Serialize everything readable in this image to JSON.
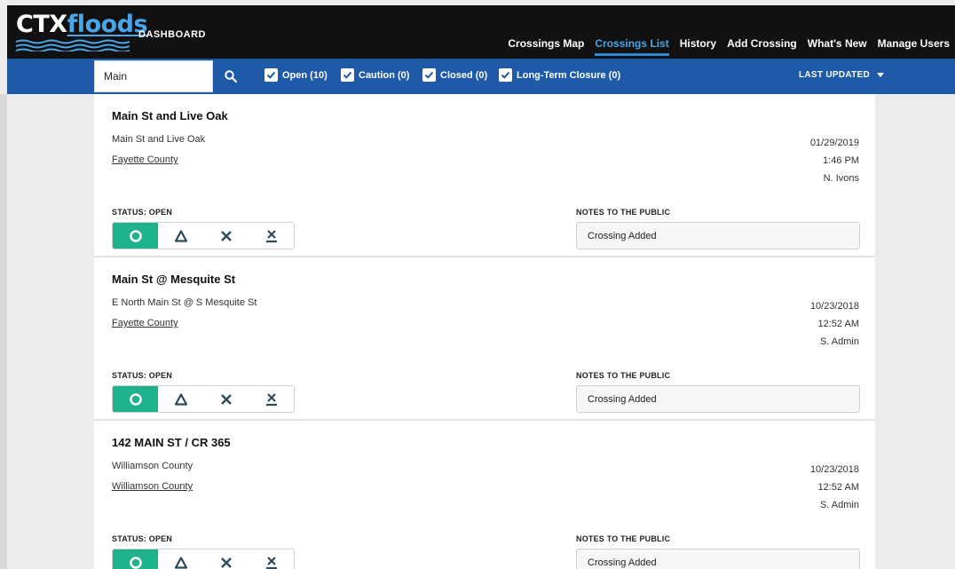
{
  "header": {
    "logo_text_1": "CTX",
    "logo_text_2": "floods",
    "section_label": "DASHBOARD",
    "nav": [
      {
        "label": "Crossings Map"
      },
      {
        "label": "Crossings List"
      },
      {
        "label": "History"
      },
      {
        "label": "Add Crossing"
      },
      {
        "label": "What's New"
      },
      {
        "label": "Manage Users"
      }
    ],
    "active_nav": "Crossings List",
    "colors": {
      "bar": "#111111",
      "accent": "#49a6ea"
    }
  },
  "filters": {
    "search_value": "Main",
    "search_icon": "search-icon",
    "options": [
      {
        "label": "Open (10)",
        "checked": true
      },
      {
        "label": "Caution (0)",
        "checked": true
      },
      {
        "label": "Closed (0)",
        "checked": true
      },
      {
        "label": "Long-Term Closure (0)",
        "checked": true
      }
    ],
    "sort_label": "LAST UPDATED",
    "colors": {
      "bar": "#1f5aa8"
    }
  },
  "crossings": [
    {
      "title": "Main St and Live Oak",
      "address": "Main St and Live Oak",
      "county": "Fayette County",
      "date": "01/29/2019",
      "time": "1:46 PM",
      "user": "N. Ivons",
      "status_label": "STATUS: OPEN",
      "notes_label": "NOTES TO THE PUBLIC",
      "notes": "Crossing Added",
      "active_status": "open"
    },
    {
      "title": "Main St @ Mesquite St",
      "address": "E North Main St @ S Mesquite St",
      "county": "Fayette County",
      "date": "10/23/2018",
      "time": "12:52 AM",
      "user": "S. Admin",
      "status_label": "STATUS: OPEN",
      "notes_label": "NOTES TO THE PUBLIC",
      "notes": "Crossing Added",
      "active_status": "open"
    },
    {
      "title": "142 MAIN ST / CR 365",
      "address": "Williamson County",
      "county": "Williamson County",
      "date": "10/23/2018",
      "time": "12:52 AM",
      "user": "S. Admin",
      "status_label": "STATUS: OPEN",
      "notes_label": "NOTES TO THE PUBLIC",
      "notes": "Crossing Added",
      "active_status": "open"
    }
  ],
  "status_buttons": [
    {
      "key": "open",
      "icon": "open-circle-icon"
    },
    {
      "key": "caution",
      "icon": "caution-triangle-icon"
    },
    {
      "key": "closed",
      "icon": "closed-x-icon"
    },
    {
      "key": "long-term",
      "icon": "long-term-closure-icon"
    }
  ],
  "status_colors": {
    "open_active": "#1eb38c",
    "icon": "#2d4a5c"
  }
}
